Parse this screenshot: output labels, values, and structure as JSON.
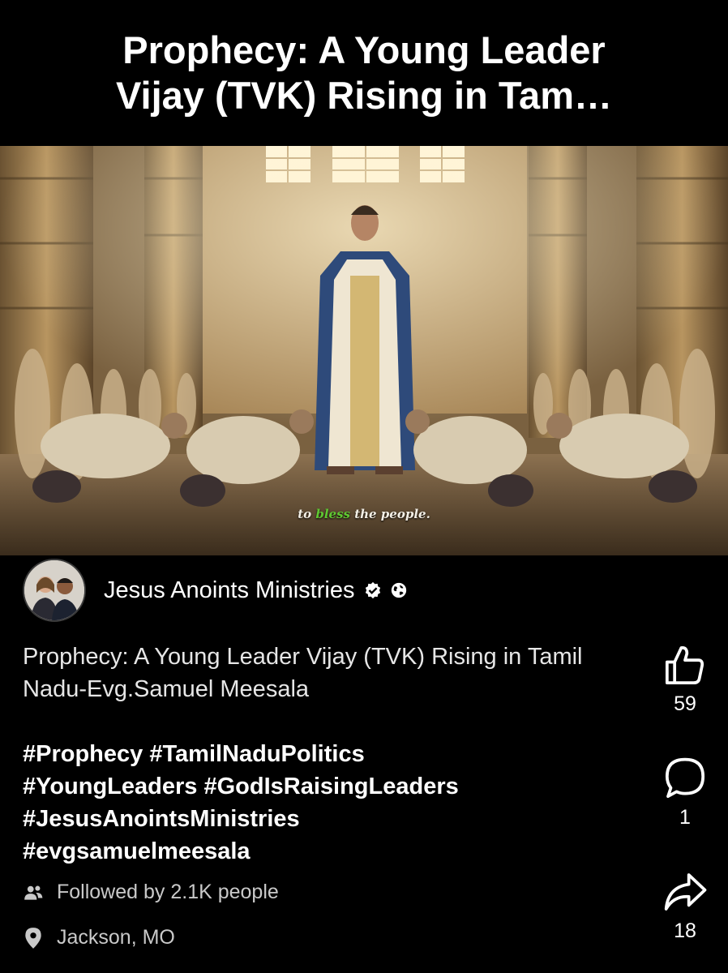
{
  "header": {
    "title": "Prophecy: A Young Leader Vijay (TVK) Rising in Tam…"
  },
  "video": {
    "caption_before": "to ",
    "caption_highlight": "bless",
    "caption_after": " the people.",
    "highlight_color": "#5fc832"
  },
  "author": {
    "name": "Jesus Anoints Ministries",
    "verified": true,
    "audience_icon": "globe-icon"
  },
  "post": {
    "description": "Prophecy: A Young Leader Vijay (TVK) Rising in Tamil Nadu-Evg.Samuel Meesala",
    "hashtags_line1": "#Prophecy #TamilNaduPolitics",
    "hashtags_line2": "#YoungLeaders #GodIsRaisingLeaders",
    "hashtags_line3": "#JesusAnointsMinistries",
    "hashtags_line4": "#evgsamuelmeesala",
    "followed_by": "Followed by 2.1K people",
    "location": "Jackson, MO"
  },
  "actions": {
    "likes": "59",
    "comments": "1",
    "shares": "18"
  },
  "icons": {
    "like": "thumbs-up-icon",
    "comment": "comment-bubble-icon",
    "share": "share-arrow-icon",
    "followers": "people-icon",
    "location": "location-pin-icon"
  }
}
